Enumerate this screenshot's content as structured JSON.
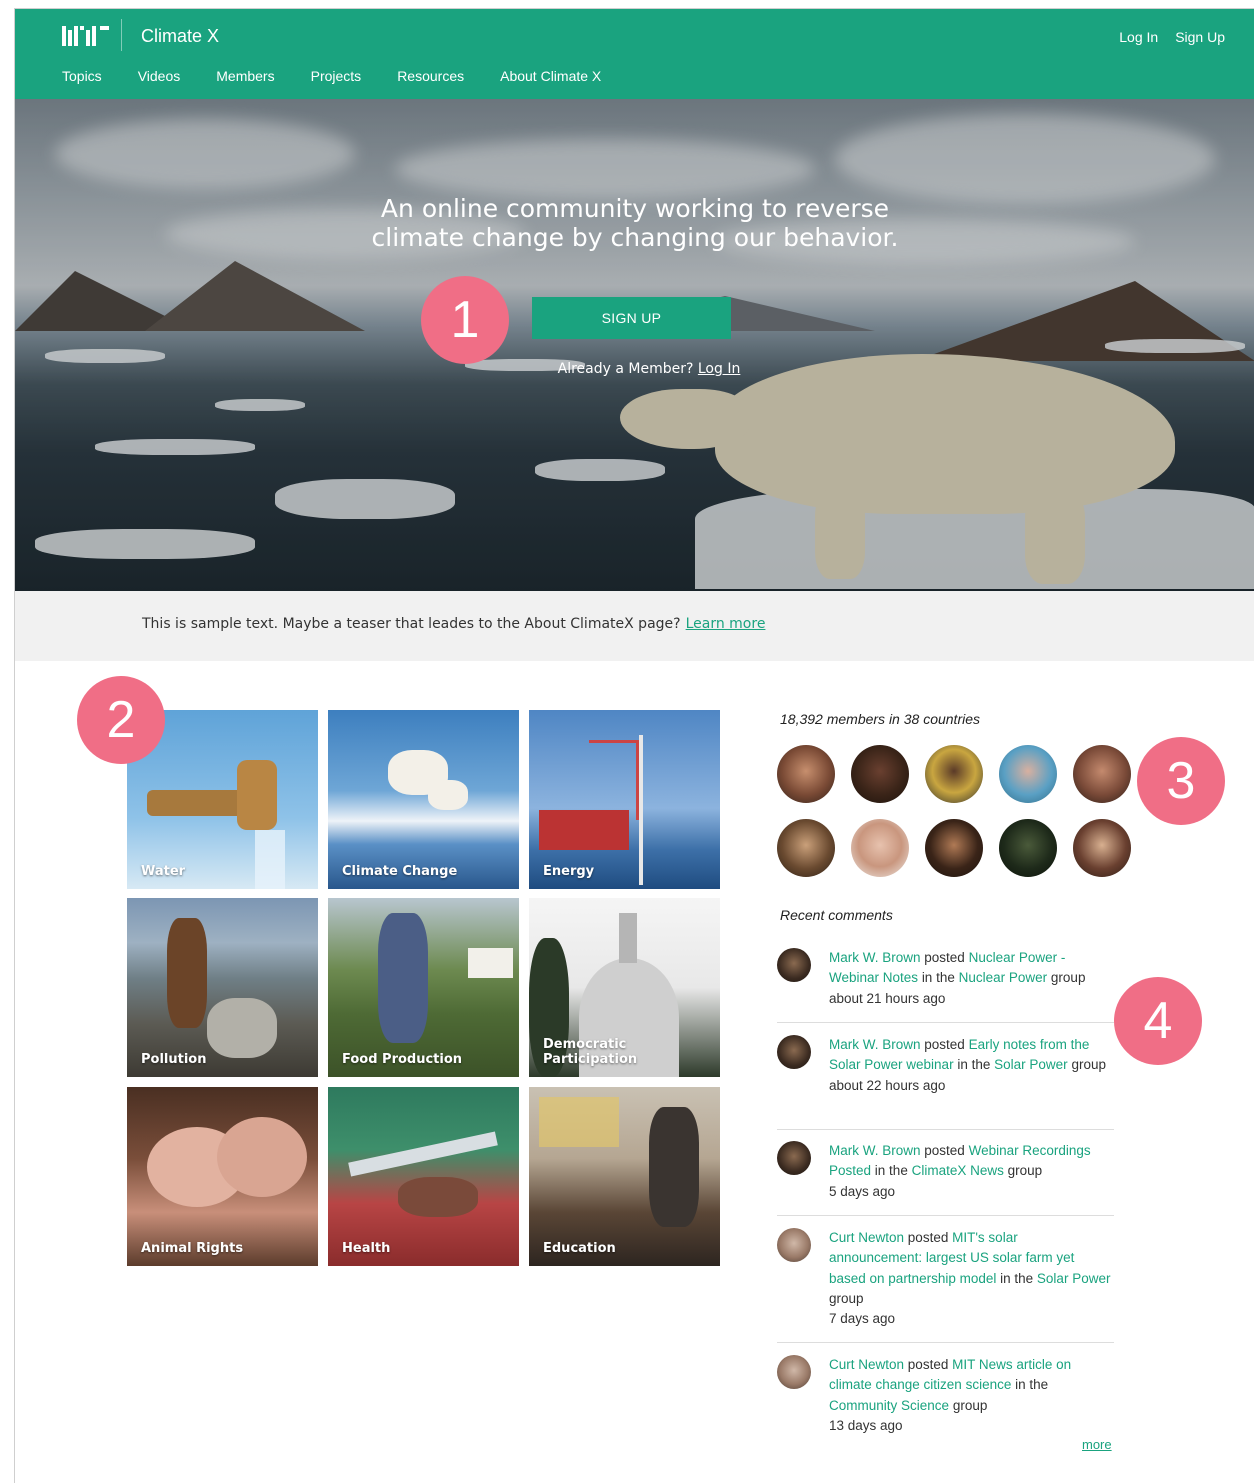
{
  "header": {
    "brand": "Climate X",
    "logo_text": "MIT",
    "log_in": "Log In",
    "sign_up": "Sign Up",
    "nav": [
      "Topics",
      "Videos",
      "Members",
      "Projects",
      "Resources",
      "About Climate X"
    ],
    "active_nav": "Members",
    "color": "#1aa37f"
  },
  "hero": {
    "title_line1": "An online community working to reverse",
    "title_line2": "climate change by changing our behavior.",
    "signup_label": "SIGN UP",
    "already_text": "Already a Member?",
    "login_link": "Log In"
  },
  "callouts": [
    "1",
    "2",
    "3",
    "4"
  ],
  "teaser": {
    "text": "This is sample text. Maybe a teaser that leades to the About ClimateX page?",
    "link": "Learn more"
  },
  "topics": [
    "Water",
    "Climate Change",
    "Energy",
    "Pollution",
    "Food Production",
    "Democratic Participation",
    "Animal Rights",
    "Health",
    "Education"
  ],
  "members": {
    "count_text": "18,392 members in 38 countries"
  },
  "recent": {
    "title": "Recent comments",
    "comments": [
      {
        "user": "Mark W. Brown",
        "verb": "posted",
        "post": "Nuclear Power - Webinar Notes",
        "in": "in the",
        "group": "Nuclear Power",
        "group_word": "group",
        "time": "about 21 hours ago"
      },
      {
        "user": "Mark W. Brown",
        "verb": "posted",
        "post": "Early notes from the Solar Power webinar",
        "in": "in the",
        "group": "Solar Power",
        "group_word": "group",
        "time": "about 22 hours ago"
      },
      {
        "user": "Mark W. Brown",
        "verb": "posted",
        "post": "Webinar Recordings Posted",
        "in": "in the",
        "group": "ClimateX News",
        "group_word": "group",
        "time": "5 days ago"
      },
      {
        "user": "Curt Newton",
        "verb": "posted",
        "post": "MIT's solar announcement: largest US solar farm yet based on partnership model",
        "in": "in the",
        "group": "Solar Power",
        "group_word": "group",
        "time": "7 days ago"
      },
      {
        "user": "Curt Newton",
        "verb": "posted",
        "post": "MIT News article on climate change citizen science",
        "in": "in the",
        "group": "Community Science",
        "group_word": "group",
        "time": "13 days ago"
      }
    ],
    "more": "more"
  }
}
